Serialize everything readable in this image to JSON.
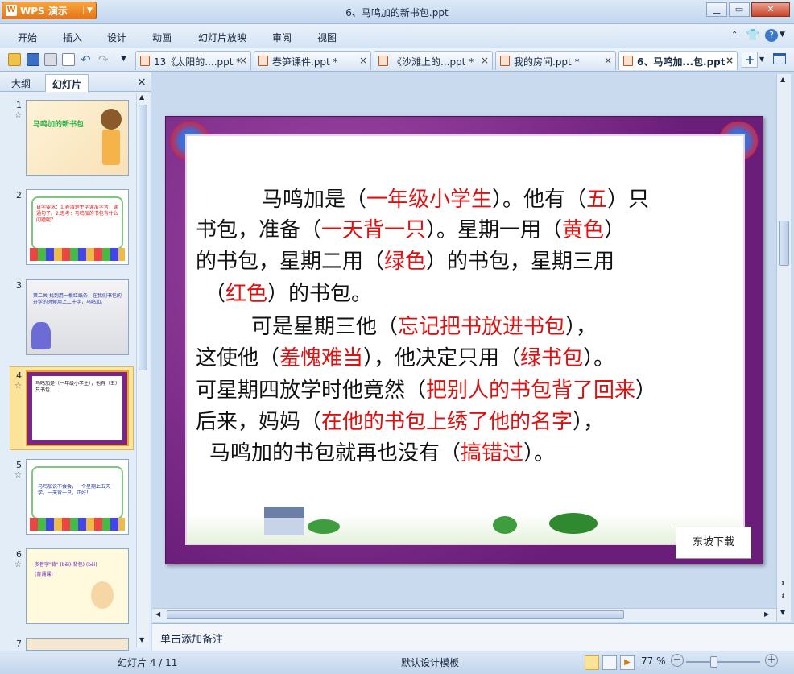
{
  "app": {
    "name": "WPS 演示",
    "window_title": "6、马鸣加的新书包.ppt"
  },
  "menu": [
    "开始",
    "插入",
    "设计",
    "动画",
    "幻灯片放映",
    "审阅",
    "视图"
  ],
  "tabs": [
    {
      "label": "13《太阳的....ppt *"
    },
    {
      "label": "春笋课件.ppt *"
    },
    {
      "label": "《沙滩上的...ppt *"
    },
    {
      "label": "我的房间.ppt *"
    },
    {
      "label": "6、马鸣加...包.ppt"
    }
  ],
  "left_pane": {
    "tab_outline": "大纲",
    "tab_slides": "幻灯片",
    "close": "×",
    "slides": [
      {
        "num": "1",
        "text": "马鸣加的新书包"
      },
      {
        "num": "2",
        "text": "自学要求：1.弄清楚生字读准字音，读通句子。2.思考：马鸣加的书包有什么问题呢？"
      },
      {
        "num": "3",
        "text": "第二关  找到用一根红纸条，在我们书包的开学的时候用上二十字，马鸣加。"
      },
      {
        "num": "4",
        "text": "马鸣加是（一年级小学生），他有（五）只书包……"
      },
      {
        "num": "5",
        "text": "马鸣加说不会会，一个星期上五天学，一天背一只，正好！"
      },
      {
        "num": "6",
        "text": "多音字\"背\" (bēi)(背包) (bèi)(背诵课)"
      },
      {
        "num": "7",
        "text": ""
      }
    ]
  },
  "slide": {
    "lines": [
      {
        "parts": [
          {
            "t": "马鸣加是（",
            "a": false
          },
          {
            "t": "一年级小学生",
            "a": true
          },
          {
            "t": "）。他有（",
            "a": false
          },
          {
            "t": "五",
            "a": true
          },
          {
            "t": "）只",
            "a": false
          }
        ]
      },
      {
        "parts": [
          {
            "t": "书包，准备（",
            "a": false
          },
          {
            "t": "一天背一只",
            "a": true
          },
          {
            "t": "）。星期一用（",
            "a": false
          },
          {
            "t": "黄色",
            "a": true
          },
          {
            "t": "）",
            "a": false
          }
        ]
      },
      {
        "parts": [
          {
            "t": "的书包，星期二用（",
            "a": false
          },
          {
            "t": "绿色",
            "a": true
          },
          {
            "t": "）的书包，星期三用",
            "a": false
          }
        ]
      },
      {
        "parts": [
          {
            "t": "（",
            "a": false
          },
          {
            "t": "红色",
            "a": true
          },
          {
            "t": "）的书包。",
            "a": false
          }
        ]
      },
      {
        "parts": [
          {
            "t": "可是星期三他（",
            "a": false
          },
          {
            "t": "忘记把书放进书包",
            "a": true
          },
          {
            "t": "），",
            "a": false
          }
        ]
      },
      {
        "parts": [
          {
            "t": "这使他（",
            "a": false
          },
          {
            "t": "羞愧难当",
            "a": true
          },
          {
            "t": "），他决定只用（",
            "a": false
          },
          {
            "t": "绿书包",
            "a": true
          },
          {
            "t": "）。",
            "a": false
          }
        ]
      },
      {
        "parts": [
          {
            "t": "可星期四放学时他竟然（",
            "a": false
          },
          {
            "t": "把别人的书包背了回来",
            "a": true
          },
          {
            "t": "）",
            "a": false
          }
        ]
      },
      {
        "parts": [
          {
            "t": "后来，妈妈（",
            "a": false
          },
          {
            "t": "在他的书包上绣了他的名字",
            "a": true
          },
          {
            "t": "），",
            "a": false
          }
        ]
      },
      {
        "parts": [
          {
            "t": "马鸣加的书包就再也没有（",
            "a": false
          },
          {
            "t": "搞错过",
            "a": true
          },
          {
            "t": "）。",
            "a": false
          }
        ]
      }
    ],
    "watermark": "东坡下载"
  },
  "notes_placeholder": "单击添加备注",
  "status": {
    "slide_info": "幻灯片 4 / 11",
    "template": "默认设计模板",
    "zoom": "77 %"
  },
  "colors": {
    "answer": "#e01010",
    "slide_frame": "#7b2589",
    "accent": "#e5761a"
  }
}
